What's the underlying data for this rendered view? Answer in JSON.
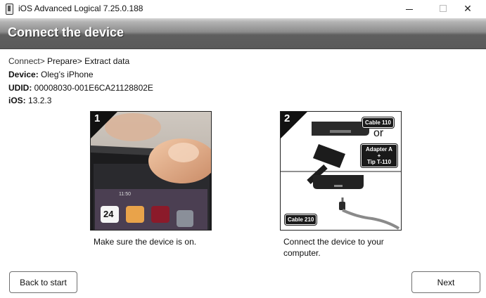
{
  "window": {
    "title": "iOS Advanced Logical 7.25.0.188",
    "minimize_glyph": "—",
    "maximize_glyph": "☐",
    "close_glyph": "✕"
  },
  "header": {
    "title": "Connect the device"
  },
  "breadcrumb": {
    "steps": [
      "Connect>",
      "Prepare>",
      "Extract data"
    ]
  },
  "device_info": {
    "device_label": "Device:",
    "device_value": "Oleg’s iPhone",
    "udid_label": "UDID:",
    "udid_value": "00008030-001E6CA21128802E",
    "ios_label": "iOS:",
    "ios_value": "13.2.3"
  },
  "steps": [
    {
      "number": "1",
      "caption": "Make sure the device is on.",
      "image": {
        "date_number": "24",
        "clock": "11:50"
      }
    },
    {
      "number": "2",
      "caption": "Connect the device to your computer.",
      "image": {
        "cable_110": "Cable 110",
        "or_text": "or",
        "adapter_line1": "Adapter A",
        "adapter_line2": "+",
        "adapter_line3": "Tip T-110",
        "cable_210": "Cable 210"
      }
    }
  ],
  "buttons": {
    "back": "Back to start",
    "next": "Next"
  },
  "colors": {
    "header_band_top": "#b3b3b3",
    "header_band_bottom": "#5a5a5a",
    "header_text": "#ffffff"
  }
}
